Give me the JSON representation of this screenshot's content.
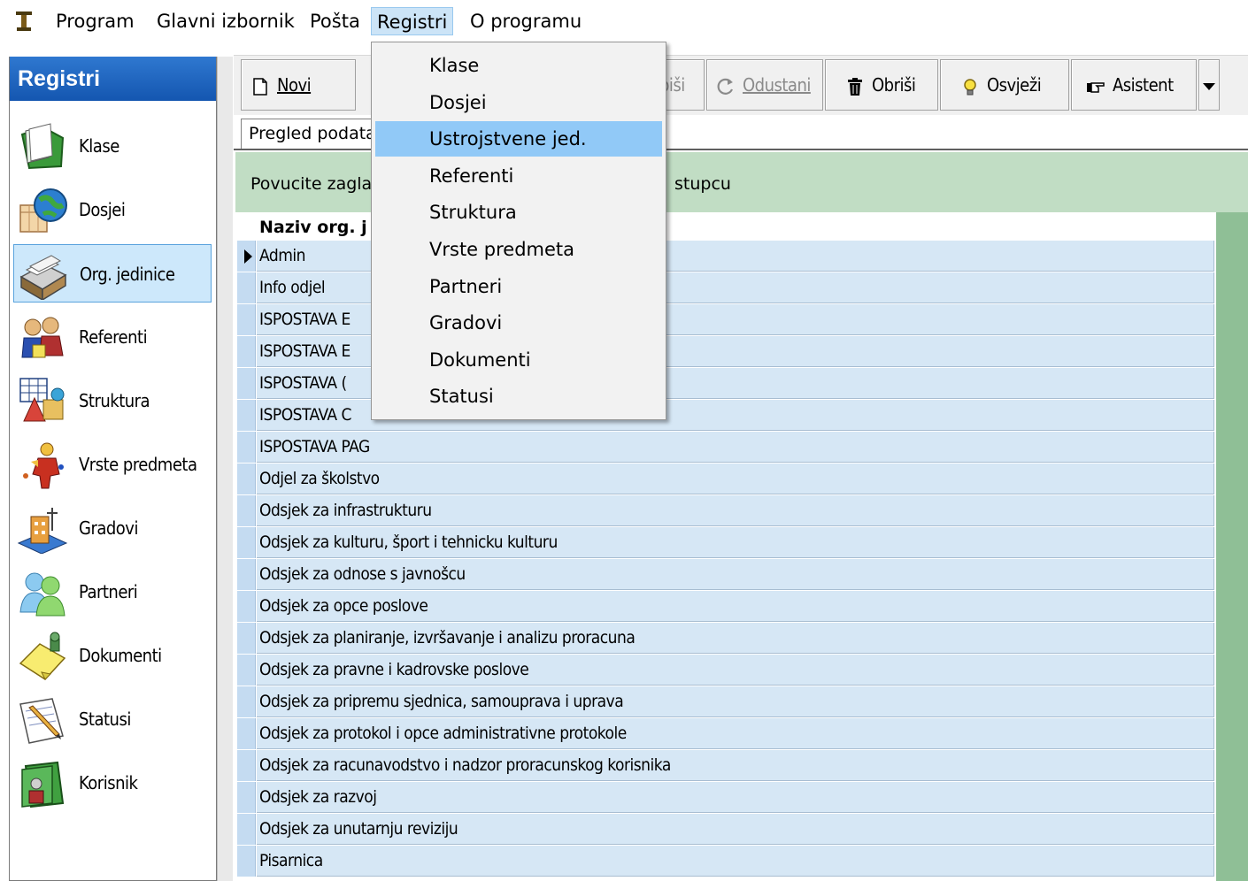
{
  "menubar": {
    "items": [
      "Program",
      "Glavni izbornik",
      "Pošta",
      "Registri",
      "O programu"
    ]
  },
  "sidebar": {
    "title": "Registri",
    "items": [
      {
        "label": "Klase",
        "icon": "folder-icon"
      },
      {
        "label": "Dosjei",
        "icon": "globe-calendar-icon"
      },
      {
        "label": "Org. jedinice",
        "icon": "card-file-icon"
      },
      {
        "label": "Referenti",
        "icon": "people-icon"
      },
      {
        "label": "Struktura",
        "icon": "structure-icon"
      },
      {
        "label": "Vrste predmeta",
        "icon": "figure-icon"
      },
      {
        "label": "Gradovi",
        "icon": "city-icon"
      },
      {
        "label": "Partneri",
        "icon": "partners-icon"
      },
      {
        "label": "Dokumenti",
        "icon": "document-pin-icon"
      },
      {
        "label": "Statusi",
        "icon": "pencil-paper-icon"
      },
      {
        "label": "Korisnik",
        "icon": "user-folder-icon"
      }
    ],
    "selected": "Org. jedinice"
  },
  "toolbar": {
    "novi": "Novi",
    "spremi_partial": "piši",
    "odustani": "Odustani",
    "obrisi": "Obriši",
    "osvjezi": "Osvježi",
    "asistent": "Asistent"
  },
  "tabs": {
    "pregled": "Pregled podata"
  },
  "group_panel": {
    "text_left": "Povucite zagla",
    "text_right": "stupcu"
  },
  "grid": {
    "column": "Naziv org. j",
    "rows": [
      "Admin",
      "Info odjel",
      "ISPOSTAVA E",
      "ISPOSTAVA E",
      "ISPOSTAVA (",
      "ISPOSTAVA C",
      "ISPOSTAVA PAG",
      "Odjel za školstvo",
      "Odsjek za infrastrukturu",
      "Odsjek za kulturu, šport i tehnicku kulturu",
      "Odsjek za odnose s javnošcu",
      "Odsjek za opce poslove",
      "Odsjek za planiranje, izvršavanje i analizu proracuna",
      "Odsjek za pravne i kadrovske poslove",
      "Odsjek za pripremu sjednica, samouprava i uprava",
      "Odsjek za protokol i opce administrativne protokole",
      "Odsjek za racunavodstvo i nadzor proracunskog korisnika",
      "Odsjek za razvoj",
      "Odsjek za unutarnju reviziju",
      "Pisarnica"
    ]
  },
  "dropdown": {
    "items": [
      "Klase",
      "Dosjei",
      "Ustrojstvene jed.",
      "Referenti",
      "Struktura",
      "Vrste predmeta",
      "Partneri",
      "Gradovi",
      "Dokumenti",
      "Statusi"
    ],
    "highlighted": "Ustrojstvene jed."
  }
}
